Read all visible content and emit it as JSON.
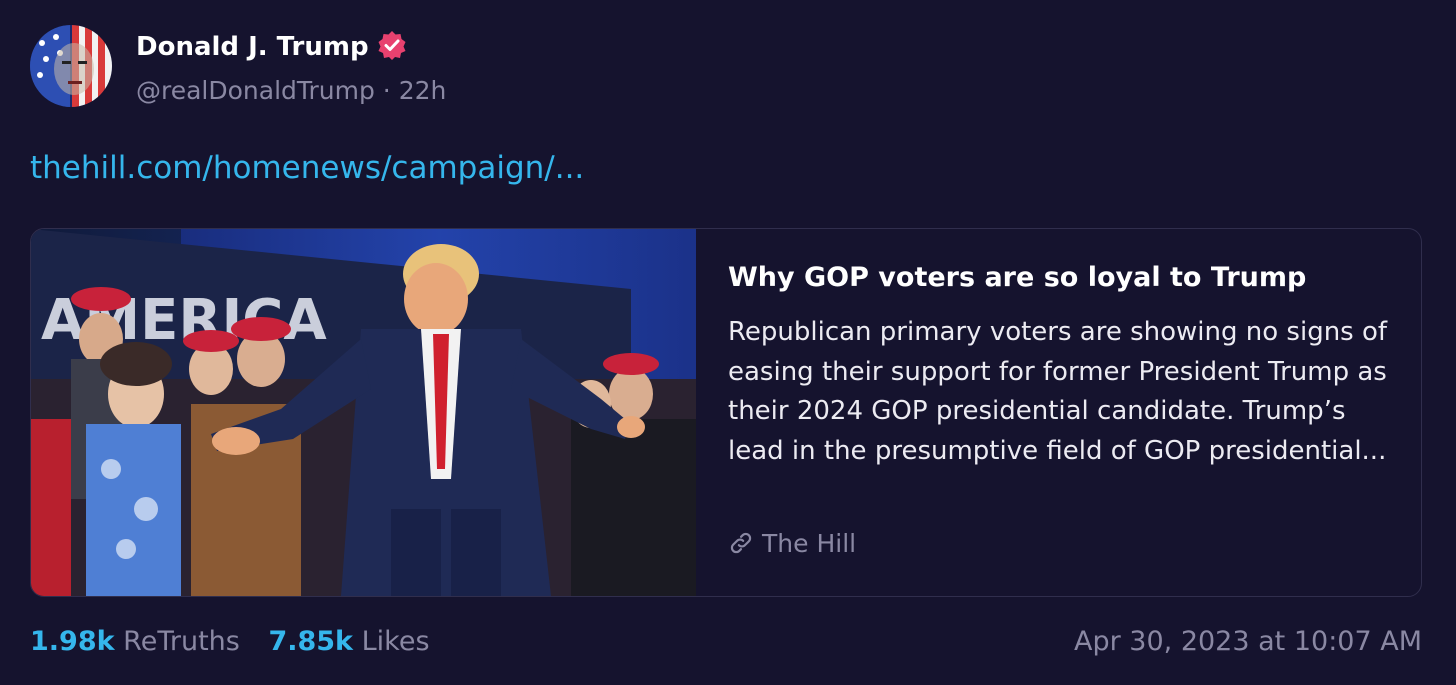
{
  "author": {
    "name": "Donald J. Trump",
    "handle": "@realDonaldTrump",
    "separator": "·",
    "age": "22h",
    "verified_color": "#e8416f"
  },
  "post": {
    "link_text": "thehill.com/homenews/campaign/..."
  },
  "card": {
    "title": "Why GOP voters are so loyal to Trump",
    "description": "Republican primary voters are showing no signs of easing their support for former President Trump as their 2024 GOP presidential candidate. Trump’s lead in the presumptive field of GOP presidential...",
    "source": "The Hill",
    "source_icon": "link-icon"
  },
  "stats": {
    "retruths_count": "1.98k",
    "retruths_label": "ReTruths",
    "likes_count": "7.85k",
    "likes_label": "Likes"
  },
  "timestamp": "Apr 30, 2023 at 10:07 AM",
  "colors": {
    "background": "#15132e",
    "accent": "#35b6ec",
    "muted": "#8a88a3"
  }
}
